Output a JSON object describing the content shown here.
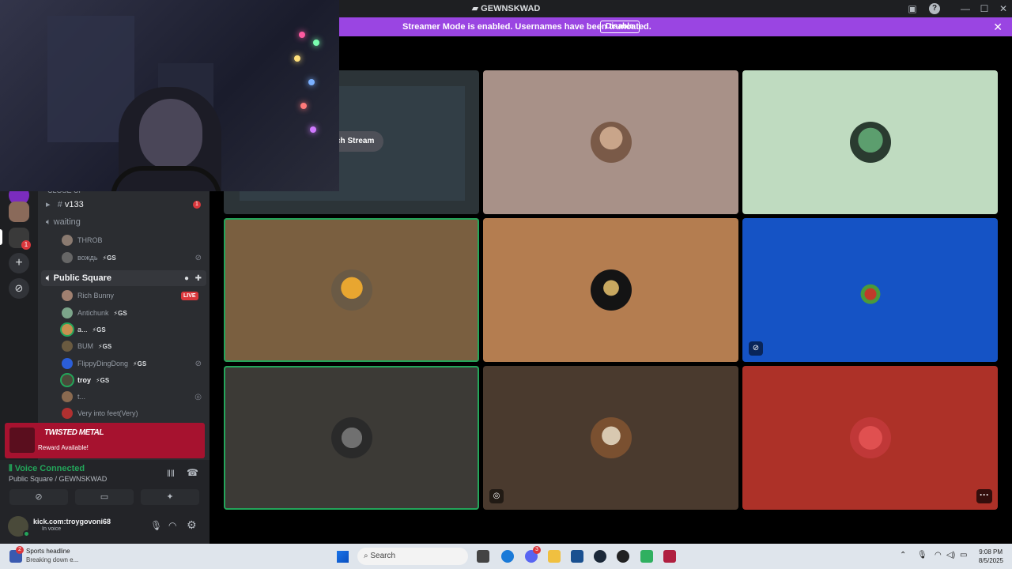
{
  "window": {
    "title": "GEWNSKWAD"
  },
  "banner": {
    "message": "Streamer Mode is enabled. Usernames have been truncated.",
    "disable_label": "Disable"
  },
  "channels": {
    "text_channel": "v133",
    "text_badge": "1",
    "waiting": "waiting",
    "waiting_users": [
      {
        "name": "THROB",
        "gs": ""
      },
      {
        "name": "вождь",
        "gs": "⚡GS"
      }
    ],
    "public_square": "Public Square",
    "public_users": [
      {
        "name": "Rich Bunny",
        "gs": "",
        "live": "LIVE"
      },
      {
        "name": "Antichunk",
        "gs": "⚡GS"
      },
      {
        "name": "a...",
        "gs": "⚡GS"
      },
      {
        "name": "BUM",
        "gs": "⚡GS"
      },
      {
        "name": "FlippyDingDong",
        "gs": "⚡GS"
      },
      {
        "name": "troy",
        "gs": "⚡GS"
      },
      {
        "name": "t...",
        "gs": ""
      },
      {
        "name": "Very into feet(Very)",
        "gs": ""
      }
    ],
    "truncated_header": "CLOSE UP"
  },
  "reward": {
    "title": "TWISTED METAL",
    "subtitle": "Reward Available!"
  },
  "voice": {
    "status": "Voice Connected",
    "location": "Public Square / GEWNSKWAD"
  },
  "user": {
    "name": "kick.com:troygovoni68",
    "status": "In voice"
  },
  "stream": {
    "watch_label": "ch Stream"
  },
  "taskbar": {
    "news_badge": "2",
    "news_title": "Sports headline",
    "news_sub": "Breaking down e...",
    "search_placeholder": "Search",
    "discord_badge": "3",
    "time": "9:08 PM",
    "date": "8/5/2025"
  },
  "colors": {
    "accent": "#9a45e2",
    "green": "#23a55a",
    "reward": "#a6122f",
    "live": "#da373c"
  }
}
